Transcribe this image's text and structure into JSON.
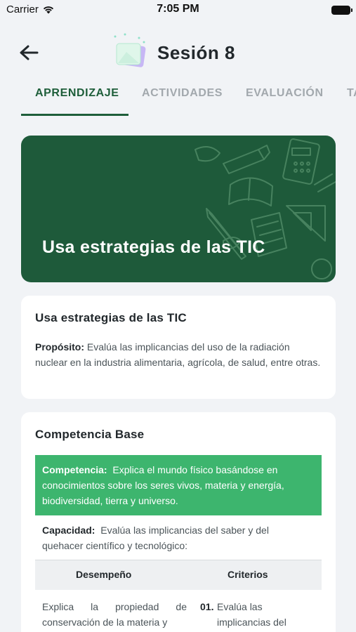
{
  "status_bar": {
    "carrier": "Carrier",
    "time": "7:05 PM"
  },
  "header": {
    "title": "Sesión 8"
  },
  "tabs": [
    {
      "label": "APRENDIZAJE"
    },
    {
      "label": "ACTIVIDADES"
    },
    {
      "label": "EVALUACIÓN"
    },
    {
      "label": "TAREA"
    }
  ],
  "banner": {
    "title": "Usa estrategias de las TIC"
  },
  "card1": {
    "title": "Usa estrategias de las TIC",
    "purpose_label": "Propósito:",
    "purpose_text": "Evalúa las implicancias del uso de la radiación nuclear en la industria alimentaria, agrícola, de salud, entre otras."
  },
  "card2": {
    "title": "Competencia Base",
    "competencia_label": "Competencia:",
    "competencia_text": "Explica el mundo físico basándose en conocimientos sobre los seres vivos, materia y energía, biodiversidad, tierra y universo.",
    "capacidad_label": "Capacidad:",
    "capacidad_text": "Evalúa las implicancias del saber y del quehacer científico y tecnológico:",
    "table": {
      "headers": [
        "Desempeño",
        "Criterios"
      ],
      "row1": {
        "desempeno": "Explica la propiedad de conservación de la materia y",
        "criterio_num": "01.",
        "criterio": "Evalúa las implicancias del"
      }
    }
  },
  "colors": {
    "primary": "#1e5e3a",
    "accent": "#3db56e",
    "banner": "#1e5a3a"
  }
}
